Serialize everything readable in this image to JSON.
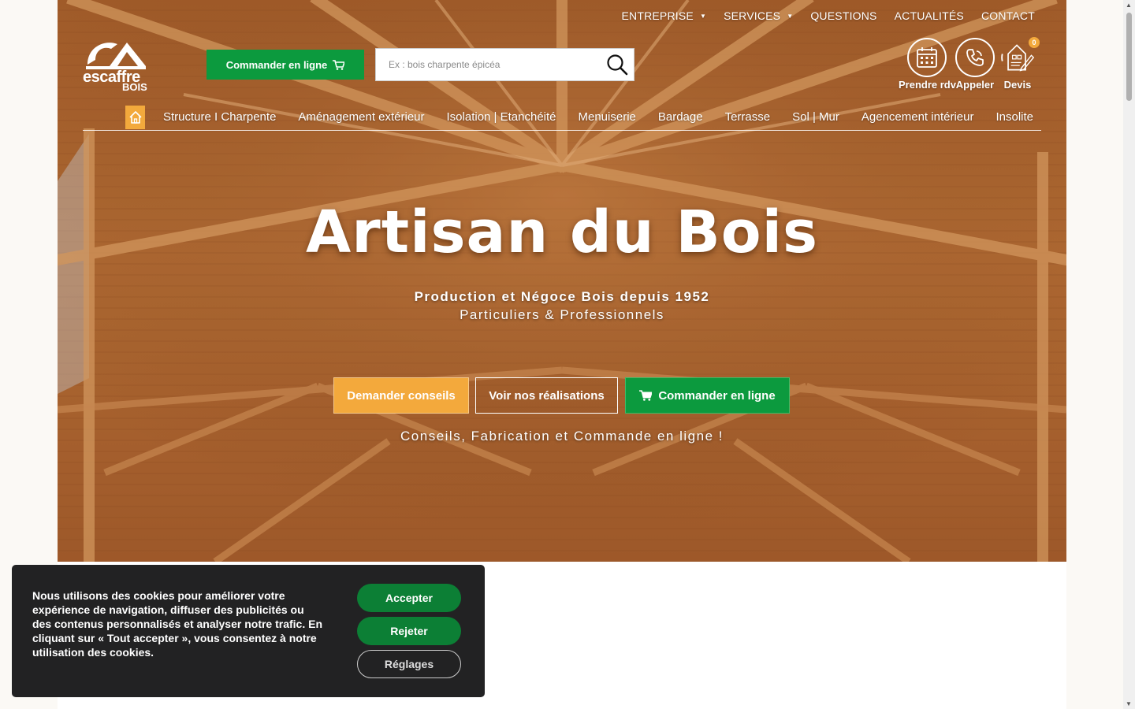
{
  "brand": {
    "name": "escaffre",
    "sub": "BOIS"
  },
  "topnav": [
    {
      "label": "ENTREPRISE",
      "dropdown": true
    },
    {
      "label": "SERVICES",
      "dropdown": true
    },
    {
      "label": "QUESTIONS",
      "dropdown": false
    },
    {
      "label": "ACTUALITÉS",
      "dropdown": false
    },
    {
      "label": "CONTACT",
      "dropdown": false
    }
  ],
  "order_button": {
    "label": "Commander en ligne"
  },
  "search": {
    "placeholder": "Ex : bois charpente épicéa"
  },
  "quick_actions": {
    "rdv": "Prendre rdv",
    "call": "Appeler",
    "devis": "Devis",
    "devis_count": "0"
  },
  "mainnav": [
    "Structure I Charpente",
    "Aménagement extérieur",
    "Isolation | Etanchéité",
    "Menuiserie",
    "Bardage",
    "Terrasse",
    "Sol | Mur",
    "Agencement intérieur",
    "Insolite"
  ],
  "hero": {
    "title": "Artisan du Bois",
    "subtitle_1": "Production et Négoce Bois depuis 1952",
    "subtitle_2": "Particuliers & Professionnels",
    "cta_conseils": "Demander conseils",
    "cta_realisations": "Voir nos réalisations",
    "cta_commander": "Commander en ligne",
    "tagline": "Conseils, Fabrication et Commande en ligne !"
  },
  "cookie": {
    "message": "Nous utilisons des cookies pour améliorer votre expérience de navigation, diffuser des publicités ou des contenus personnalisés et analyser notre trafic. En cliquant sur « Tout accepter », vous consentez à notre utilisation des cookies.",
    "accept": "Accepter",
    "reject": "Rejeter",
    "settings": "Réglages"
  },
  "colors": {
    "green": "#0c9a3e",
    "orange": "#f3a93c",
    "wood": "#b26a34"
  }
}
